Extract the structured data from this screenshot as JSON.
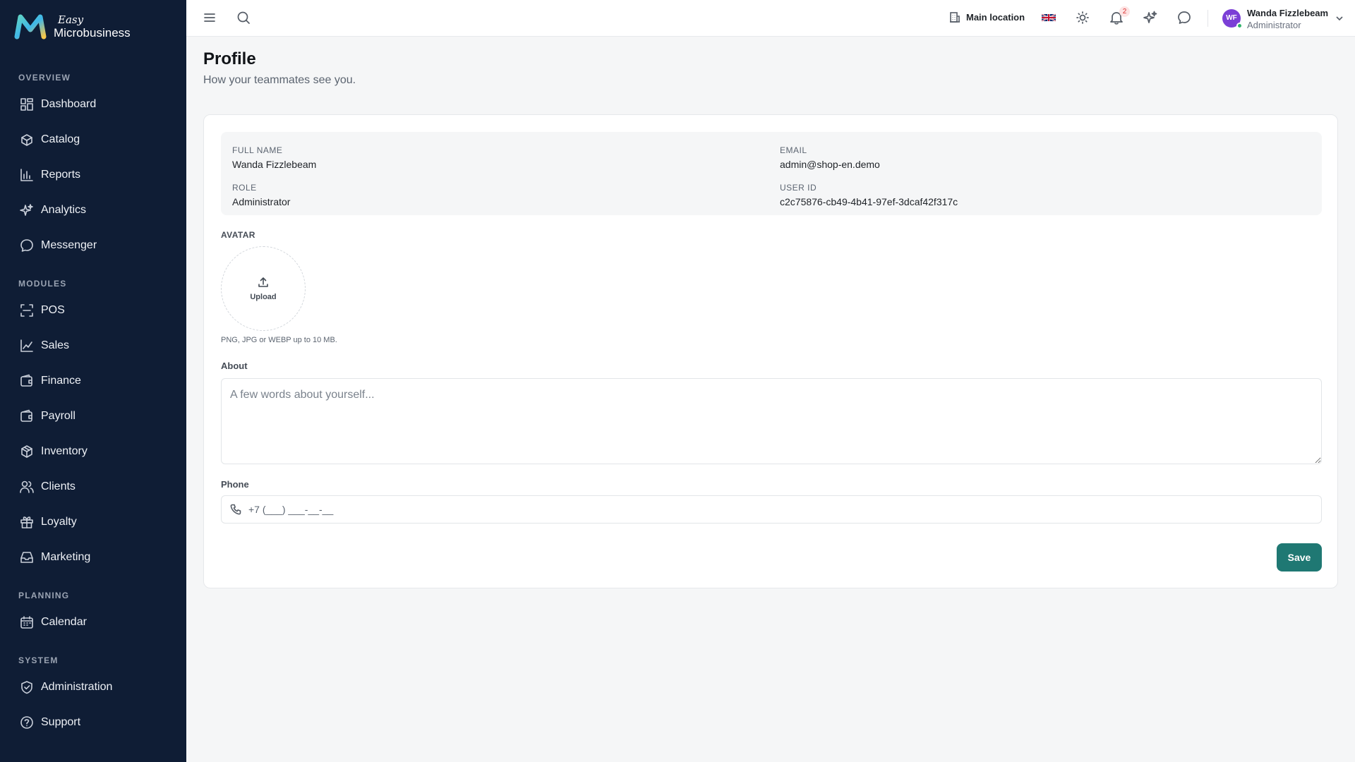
{
  "brand": {
    "easy": "Easy",
    "name": "Microbusiness"
  },
  "sidebar": {
    "sections": [
      {
        "title": "OVERVIEW",
        "items": [
          {
            "label": "Dashboard",
            "icon": "dashboard-icon"
          },
          {
            "label": "Catalog",
            "icon": "catalog-icon"
          },
          {
            "label": "Reports",
            "icon": "reports-icon"
          },
          {
            "label": "Analytics",
            "icon": "sparkle-icon"
          },
          {
            "label": "Messenger",
            "icon": "chat-icon"
          }
        ]
      },
      {
        "title": "MODULES",
        "items": [
          {
            "label": "POS",
            "icon": "scan-icon"
          },
          {
            "label": "Sales",
            "icon": "trend-icon"
          },
          {
            "label": "Finance",
            "icon": "wallet-icon"
          },
          {
            "label": "Payroll",
            "icon": "wallet-icon"
          },
          {
            "label": "Inventory",
            "icon": "box-icon"
          },
          {
            "label": "Clients",
            "icon": "users-icon"
          },
          {
            "label": "Loyalty",
            "icon": "gift-icon"
          },
          {
            "label": "Marketing",
            "icon": "inbox-icon"
          }
        ]
      },
      {
        "title": "PLANNING",
        "items": [
          {
            "label": "Calendar",
            "icon": "calendar-icon"
          }
        ]
      },
      {
        "title": "SYSTEM",
        "items": [
          {
            "label": "Administration",
            "icon": "shield-icon"
          },
          {
            "label": "Support",
            "icon": "help-icon"
          }
        ]
      }
    ]
  },
  "topbar": {
    "location": "Main location",
    "notification_count": "2",
    "user": {
      "initials": "WF",
      "name": "Wanda Fizzlebeam",
      "role": "Administrator"
    }
  },
  "page": {
    "title": "Profile",
    "subtitle": "How your teammates see you."
  },
  "profile": {
    "full_name_label": "FULL NAME",
    "full_name": "Wanda Fizzlebeam",
    "email_label": "EMAIL",
    "email": "admin@shop-en.demo",
    "role_label": "ROLE",
    "role": "Administrator",
    "user_id_label": "USER ID",
    "user_id": "c2c75876-cb49-4b41-97ef-3dcaf42f317c"
  },
  "avatar": {
    "label": "AVATAR",
    "upload_label": "Upload",
    "hint": "PNG, JPG or WEBP up to 10 MB."
  },
  "form": {
    "about_label": "About",
    "about_placeholder": "A few words about yourself...",
    "phone_label": "Phone",
    "phone_placeholder": "+7 (___) ___-__-__",
    "save_label": "Save"
  },
  "colors": {
    "sidebar_bg": "#0f1d35",
    "accent": "#1f7873",
    "avatar_bg": "#7b3fd6"
  }
}
